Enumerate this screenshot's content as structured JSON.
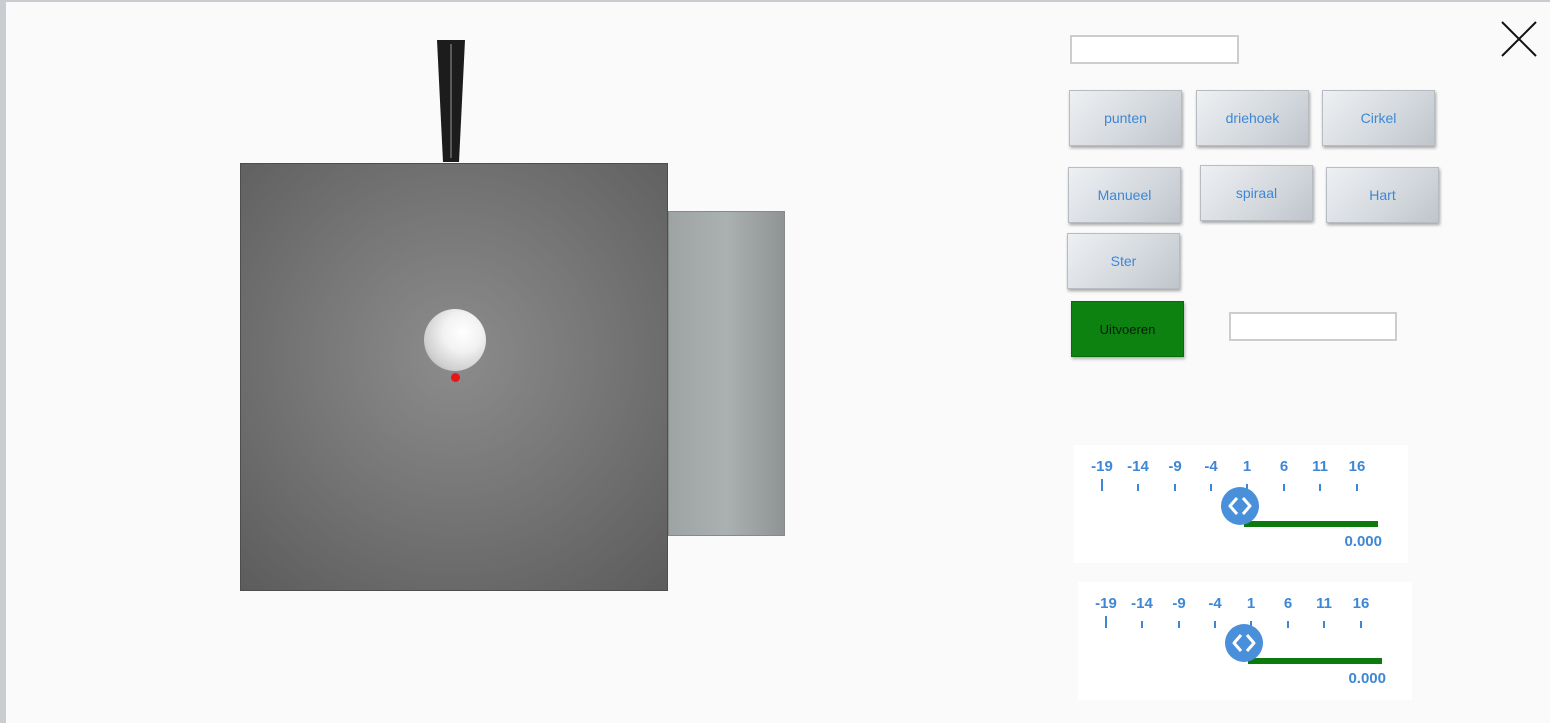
{
  "toolbar": {
    "input_top_value": "",
    "input_right_value": ""
  },
  "shape_buttons": {
    "punten": "punten",
    "driehoek": "driehoek",
    "cirkel": "Cirkel",
    "manueel": "Manueel",
    "spiraal": "spiraal",
    "hart": "Hart",
    "ster": "Ster"
  },
  "execute_label": "Uitvoeren",
  "sliders": [
    {
      "ticks": [
        "-19",
        "-14",
        "-9",
        "-4",
        "1",
        "6",
        "11",
        "16"
      ],
      "value": "0.000",
      "min": -19,
      "max": 16
    },
    {
      "ticks": [
        "-19",
        "-14",
        "-9",
        "-4",
        "1",
        "6",
        "11",
        "16"
      ],
      "value": "0.000",
      "min": -19,
      "max": 16
    }
  ],
  "colors": {
    "accent_blue": "#3d87d6",
    "execute_green": "#0d8211",
    "plotter_dot": "#e81717"
  },
  "icons": {
    "close": "close-icon",
    "slider_thumb": "chevron-left-right-icon"
  }
}
